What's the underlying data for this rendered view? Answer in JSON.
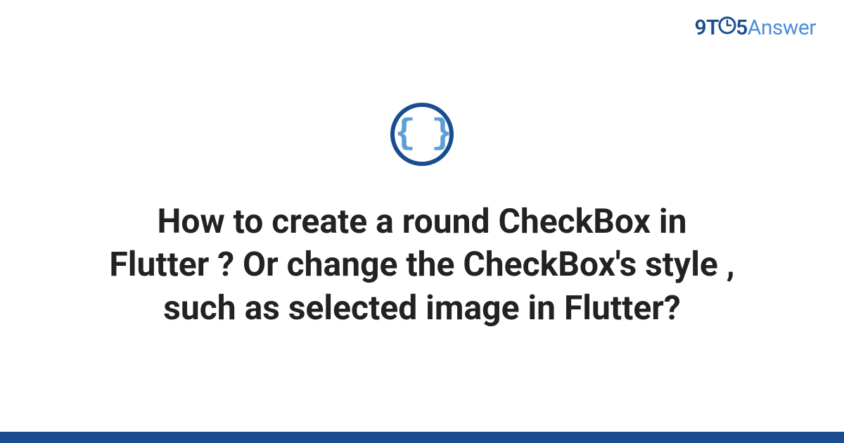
{
  "logo": {
    "nine": "9",
    "t": "T",
    "five": "5",
    "answer": "Answer"
  },
  "category": {
    "icon_name": "code-braces-icon",
    "braces_glyph": "{ }"
  },
  "title": "How to create a round CheckBox in Flutter ? Or change the CheckBox's style , such as selected image in Flutter?",
  "colors": {
    "brand_dark": "#1a4d8f",
    "brand_light": "#4a8fd8",
    "icon_inner": "#5a9fd8",
    "text": "#222222",
    "background": "#ffffff"
  }
}
